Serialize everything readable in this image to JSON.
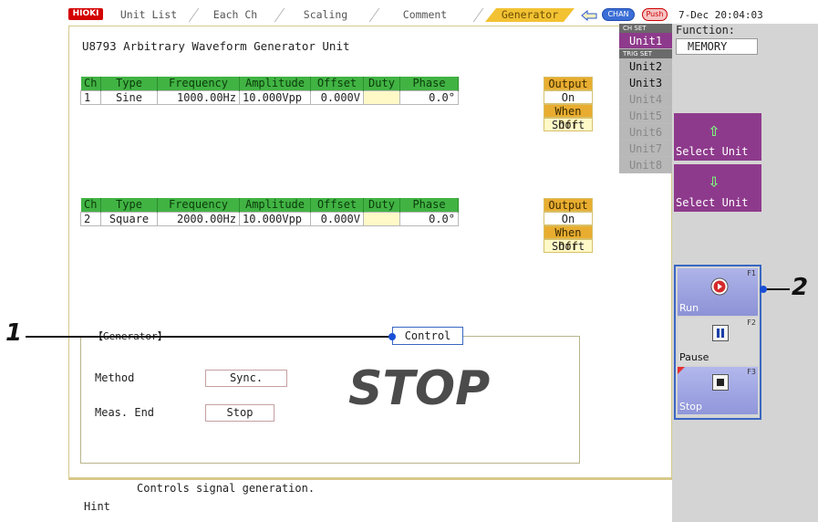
{
  "topbar": {
    "logo": "HIOKI",
    "tabs": [
      "Unit List",
      "Each Ch",
      "Scaling",
      "Comment",
      "Generator"
    ],
    "active_tab": "Generator",
    "chan_label": "CHAN",
    "push_label": "Push",
    "datetime": "7-Dec 20:04:03"
  },
  "main": {
    "title": "U8793  Arbitrary Waveform Generator Unit",
    "columns": [
      "Ch",
      "Type",
      "Frequency",
      "Amplitude",
      "Offset",
      "Duty",
      "Phase"
    ],
    "channels": [
      {
        "ch": "1",
        "type": "Sine",
        "frequency": "1000.00Hz",
        "amplitude": "10.000Vpp",
        "offset": "0.000V",
        "duty": "",
        "phase": "0.0°",
        "output_label": "Output",
        "output_value": "On",
        "when_off_label": "When Off",
        "when_off_value": "Short"
      },
      {
        "ch": "2",
        "type": "Square",
        "frequency": "2000.00Hz",
        "amplitude": "10.000Vpp",
        "offset": "0.000V",
        "duty": "",
        "phase": "0.0°",
        "output_label": "Output",
        "output_value": "On",
        "when_off_label": "When Off",
        "when_off_value": "Short"
      }
    ],
    "generator_section": "【Generator】",
    "control_button": "Control",
    "method_label": "Method",
    "method_value": "Sync.",
    "meas_end_label": "Meas. End",
    "meas_end_value": "Stop",
    "status": "STOP"
  },
  "hint": {
    "label": "Hint",
    "text": "Controls signal generation."
  },
  "right": {
    "chset": "CH SET",
    "trigset": "TRIG SET",
    "units": [
      "Unit1",
      "Unit2",
      "Unit3",
      "Unit4",
      "Unit5",
      "Unit6",
      "Unit7",
      "Unit8"
    ],
    "function_label": "Function:",
    "function_value": "MEMORY",
    "select_up": "Select Unit",
    "select_down": "Select Unit",
    "fkeys": [
      {
        "num": "F1",
        "label": "Run"
      },
      {
        "num": "F2",
        "label": "Pause"
      },
      {
        "num": "F3",
        "label": "Stop"
      }
    ]
  },
  "callouts": {
    "one": "1",
    "two": "2"
  },
  "colors": {
    "accent_tab": "#f2c233",
    "channel_header": "#41b343",
    "output_header": "#e8ad30",
    "unit_active": "#8e3a8c",
    "fkey_border": "#3a66c2"
  }
}
